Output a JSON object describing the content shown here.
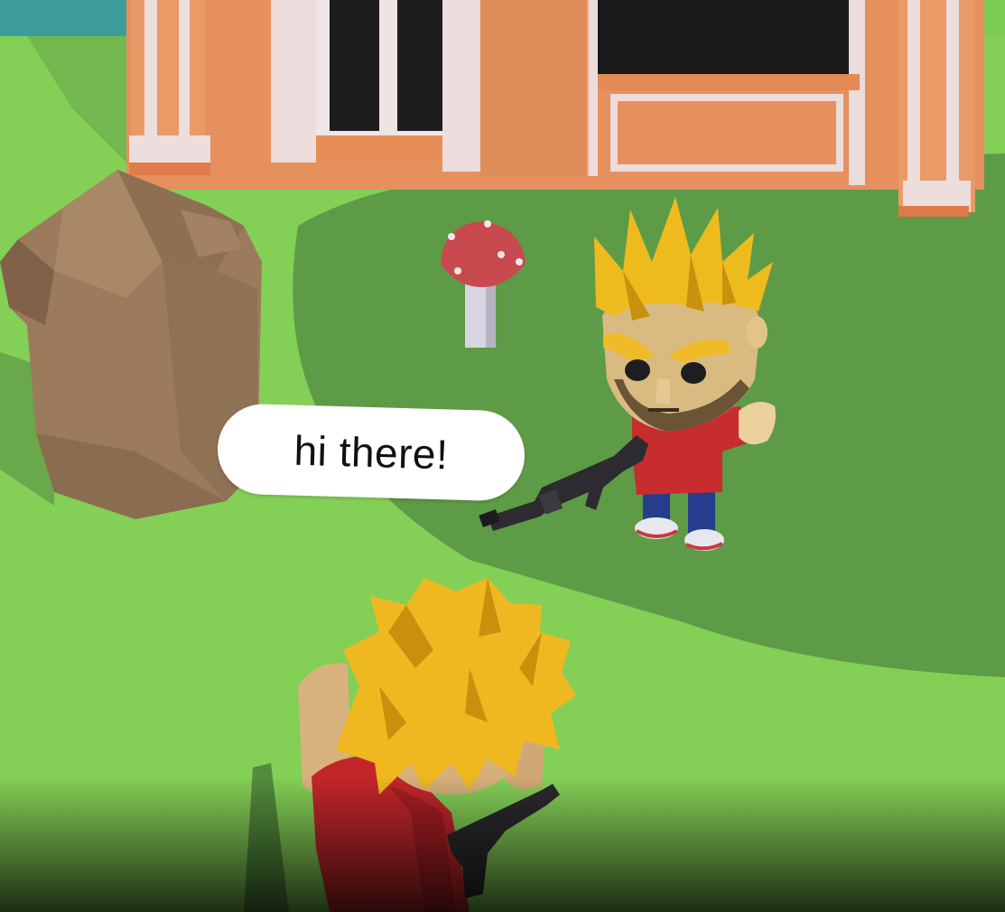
{
  "chat": {
    "speaker": "npc",
    "message": "hi there!"
  },
  "scene": {
    "objects": [
      "house",
      "rock",
      "mushroom",
      "npc-character",
      "player-character",
      "rifle-icon"
    ]
  },
  "palette": {
    "grass_light": "#82cd55",
    "grass_shadow": "#5a9a44",
    "house_wall": "#e58f5c",
    "house_trim": "#e8d6d6",
    "rock": "#9b7a5a",
    "hair": "#f2bd1e",
    "shirt": "#c52a2a",
    "mushroom_cap": "#c84a4f"
  }
}
